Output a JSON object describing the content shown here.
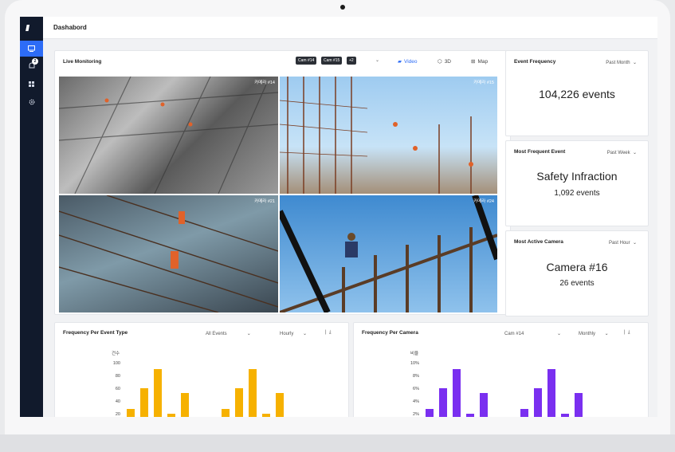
{
  "app": {
    "page_title": "Dashabord"
  },
  "sidebar": {
    "notification_count": "2"
  },
  "live": {
    "title": "Live Monitoring",
    "chips": [
      "Cam #14",
      "Cam #15",
      "+2"
    ],
    "views": [
      {
        "label": "Video",
        "icon": "video-icon"
      },
      {
        "label": "3D",
        "icon": "cube-icon"
      },
      {
        "label": "Map",
        "icon": "map-icon"
      }
    ],
    "feeds": [
      "카메라 #14",
      "카메라 #15",
      "카메라 #21",
      "카메라 #24"
    ]
  },
  "stats": [
    {
      "title": "Event Frequency",
      "period": "Past Month",
      "value": "104,226 events",
      "sub": ""
    },
    {
      "title": "Most Frequent Event",
      "period": "Past Week",
      "value": "Safety Infraction",
      "sub": "1,092 events"
    },
    {
      "title": "Most Active Camera",
      "period": "Past Hour",
      "value": "Camera #16",
      "sub": "26 events"
    }
  ],
  "chart_data": [
    {
      "type": "bar",
      "title": "Frequency Per Event Type",
      "filter": "All Events",
      "interval": "Hourly",
      "ylabel": "건수",
      "yticks": [
        "100",
        "80",
        "60",
        "40",
        "20"
      ],
      "ylim": [
        0,
        100
      ],
      "color": "#f6b100",
      "values": [
        30,
        62,
        92,
        22,
        55,
        null,
        null,
        30,
        62,
        92,
        22,
        55
      ]
    },
    {
      "type": "bar",
      "title": "Frequency Per Camera",
      "filter": "Cam #14",
      "interval": "Monthly",
      "ylabel": "비율",
      "yticks": [
        "10%",
        "8%",
        "6%",
        "4%",
        "2%"
      ],
      "ylim": [
        0,
        10
      ],
      "color": "#7a2ff0",
      "values": [
        3,
        6.2,
        9.2,
        2.2,
        5.5,
        null,
        null,
        3,
        6.2,
        9.2,
        2.2,
        5.5
      ]
    }
  ]
}
